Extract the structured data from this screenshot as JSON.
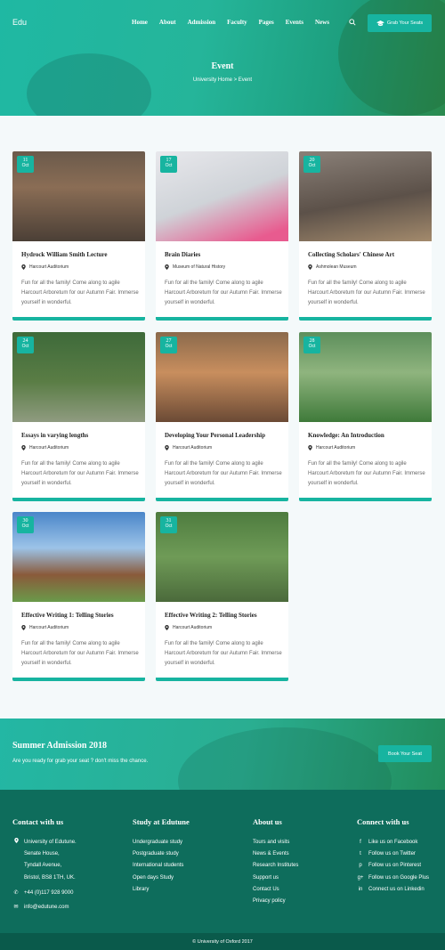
{
  "header": {
    "logo": "Edu",
    "nav": [
      "Home",
      "About",
      "Admission",
      "Faculty",
      "Pages",
      "Events",
      "News"
    ],
    "cta": "Grab Your Seats",
    "page_title": "Event",
    "breadcrumb": "University Home  > Event"
  },
  "events": [
    {
      "day": "11",
      "month": "Oct",
      "title": "Hydrock William Smith Lecture",
      "location": "Harcourt  Auditorium",
      "desc": "Fun for all the family! Come along to agile Harcourt Arboretum for our Autumn Fair. Immerse yourself in wonderful."
    },
    {
      "day": "17",
      "month": "Oct",
      "title": "Brain Diaries",
      "location": "Museum of Natural History",
      "desc": "Fun for all the family! Come along to agile Harcourt Arboretum for our Autumn Fair. Immerse yourself in wonderful."
    },
    {
      "day": "20",
      "month": "Oct",
      "title": "Collecting Scholars' Chinese Art",
      "location": "Ashmolean Museum",
      "desc": "Fun for all the family! Come along to agile Harcourt Arboretum for our Autumn Fair. Immerse yourself in wonderful."
    },
    {
      "day": "24",
      "month": "Oct",
      "title": "Essays in varying lengths",
      "location": "Harcourt  Auditorium",
      "desc": "Fun for all the family! Come along to agile Harcourt Arboretum for our Autumn Fair. Immerse yourself in wonderful."
    },
    {
      "day": "27",
      "month": "Oct",
      "title": "Developing Your Personal Leadership",
      "location": "Harcourt  Auditorium",
      "desc": "Fun for all the family! Come along to agile Harcourt Arboretum for our Autumn Fair. Immerse yourself in wonderful."
    },
    {
      "day": "28",
      "month": "Oct",
      "title": "Knowledge: An Introduction",
      "location": "Harcourt  Auditorium",
      "desc": "Fun for all the family! Come along to agile Harcourt Arboretum for our Autumn Fair. Immerse yourself in wonderful."
    },
    {
      "day": "30",
      "month": "Oct",
      "title": "Effective Writing 1: Telling Stories",
      "location": "Harcourt  Auditorium",
      "desc": "Fun for all the family! Come along to agile Harcourt Arboretum for our Autumn Fair. Immerse yourself in wonderful."
    },
    {
      "day": "31",
      "month": "Oct",
      "title": "Effective Writing 2: Telling Stories",
      "location": "Harcourt  Auditorium",
      "desc": "Fun for all the family! Come along to agile Harcourt Arboretum for our Autumn Fair. Immerse yourself in wonderful."
    }
  ],
  "banner": {
    "title": "Summer Admission 2018",
    "subtitle": "Are you ready for grab your seat ? don't miss the chance.",
    "button": "Book Your Seat"
  },
  "footer": {
    "contact": {
      "title": "Contact with us",
      "address": [
        "University of Edutune.",
        "Senate House,",
        "Tyndall Avenue,",
        "Bristol, BS8 1TH, UK."
      ],
      "phone": "+44 (0)117 928 9000",
      "email": "info@edutune.com"
    },
    "study": {
      "title": "Study at Edutune",
      "links": [
        "Undergraduate study",
        "Postgraduate study",
        "International students",
        "Open days Study",
        "Library"
      ]
    },
    "about": {
      "title": "About us",
      "links": [
        "Tours and visits",
        "News & Events",
        "Research Institutes",
        "Support us",
        "Contact Us",
        "Privacy policy"
      ]
    },
    "connect": {
      "title": "Connect with us",
      "links": [
        "Like us on Facebook",
        "Follow us on Twitter",
        "Follow us on Pinterest",
        "Follow us on Google Plus",
        "Connect us on Linkedin"
      ]
    },
    "copyright": "© University of Oxford 2017"
  },
  "colors": {
    "accent": "#17b4a0",
    "footer": "#0e6d5c",
    "footer_bottom": "#0a5a4b"
  },
  "icons": [
    "search-icon",
    "graduation-cap-icon",
    "map-pin-icon",
    "phone-icon",
    "mail-icon",
    "facebook-icon",
    "twitter-icon",
    "pinterest-icon",
    "google-plus-icon",
    "linkedin-icon"
  ]
}
